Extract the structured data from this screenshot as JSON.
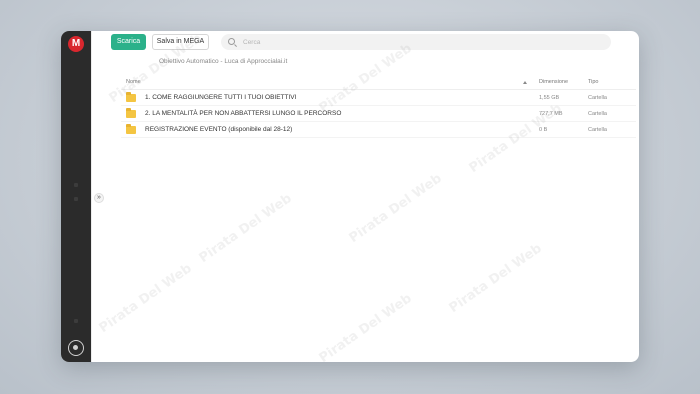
{
  "app": {
    "logo_letter": "M",
    "brand_color": "#d9272e"
  },
  "toolbar": {
    "download_label": "Scarica",
    "save_label": "Salva in MEGA",
    "search_placeholder": "Cerca"
  },
  "breadcrumb": "Obiettivo Automatico - Luca di Approccialai.it",
  "table": {
    "headers": {
      "name": "Nome",
      "size": "Dimensione",
      "type": "Tipo"
    },
    "rows": [
      {
        "name": "1. COME RAGGIUNGERE TUTTI I TUOI OBIETTIVI",
        "size": "1,55 GB",
        "type": "Cartella"
      },
      {
        "name": "2. LA MENTALITÀ PER NON ABBATTERSI LUNGO IL PERCORSO",
        "size": "727,7 MB",
        "type": "Cartella"
      },
      {
        "name": "REGISTRAZIONE EVENTO (disponibile dal 28-12)",
        "size": "0 B",
        "type": "Cartella"
      }
    ]
  },
  "watermark_text": "Pirata Del Web",
  "icons": [
    "mega-logo-icon",
    "search-icon",
    "folder-icon",
    "sort-ascending-icon",
    "expand-panel-icon",
    "transfer-manager-icon"
  ]
}
